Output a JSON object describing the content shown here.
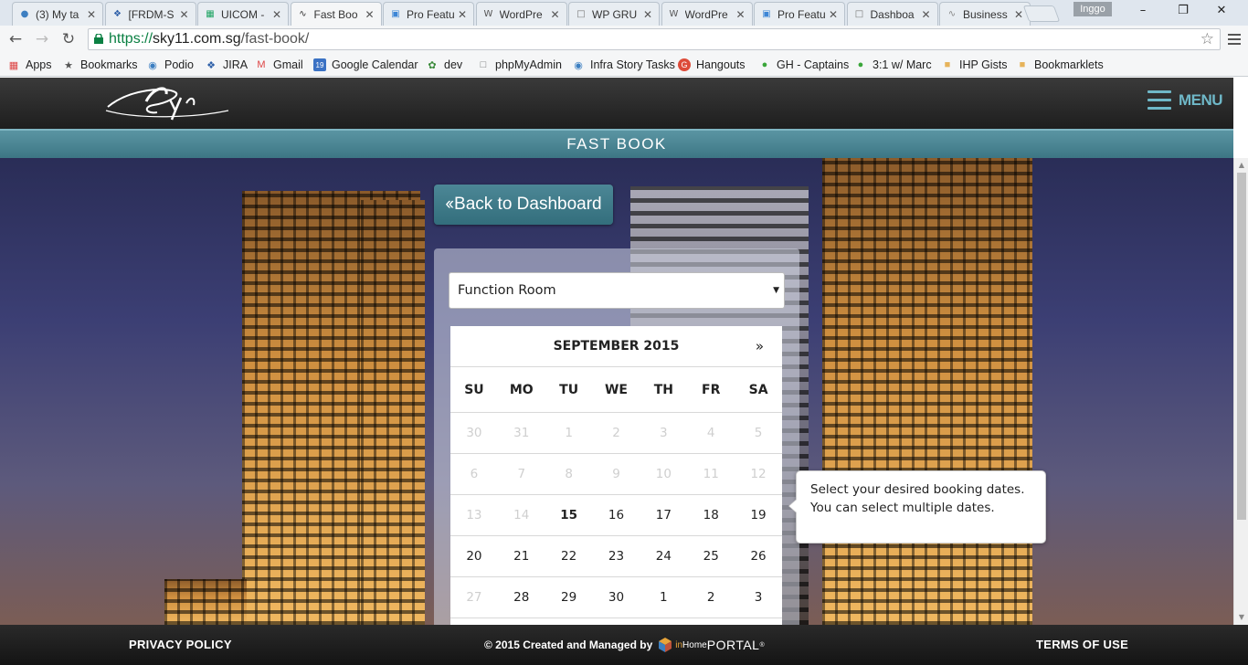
{
  "browser": {
    "tabs": [
      {
        "title": "(3) My ta",
        "icon": "podio-icon",
        "color": "#3d7fc1"
      },
      {
        "title": "[FRDM-S",
        "icon": "jira-icon",
        "color": "#2d5fa8"
      },
      {
        "title": "UICOM -",
        "icon": "sheets-icon",
        "color": "#1fa463"
      },
      {
        "title": "Fast Boo",
        "icon": "sky-icon",
        "color": "#333333",
        "active": true
      },
      {
        "title": "Pro Featu",
        "icon": "elementor-icon",
        "color": "#3d86d6"
      },
      {
        "title": "WordPre",
        "icon": "wordpress-icon",
        "color": "#555555"
      },
      {
        "title": "WP GRU",
        "icon": "page-icon",
        "color": "#777777"
      },
      {
        "title": "WordPre",
        "icon": "wordpress-icon",
        "color": "#555555"
      },
      {
        "title": "Pro Featu",
        "icon": "elementor-icon",
        "color": "#3d86d6"
      },
      {
        "title": "Dashboa",
        "icon": "page-icon",
        "color": "#777777"
      },
      {
        "title": "Business",
        "icon": "business-icon",
        "color": "#888888"
      }
    ],
    "profile_name": "Inggo",
    "url_secure": "https://",
    "url_host": "sky11.com.sg",
    "url_path": "/fast-book/",
    "bookmarks": [
      {
        "label": "Apps",
        "icon": "apps-grid-icon"
      },
      {
        "label": "Bookmarks",
        "icon": "star-icon"
      },
      {
        "label": "Podio",
        "icon": "podio-icon"
      },
      {
        "label": "JIRA",
        "icon": "jira-icon"
      },
      {
        "label": "Gmail",
        "icon": "gmail-icon"
      },
      {
        "label": "Google Calendar",
        "icon": "calendar-icon"
      },
      {
        "label": "dev",
        "icon": "leaf-icon"
      },
      {
        "label": "phpMyAdmin",
        "icon": "page-icon"
      },
      {
        "label": "Infra Story Tasks",
        "icon": "podio-icon"
      },
      {
        "label": "Hangouts",
        "icon": "google-plus-icon"
      },
      {
        "label": "GH - Captains",
        "icon": "green-dot-icon"
      },
      {
        "label": "3:1 w/ Marc",
        "icon": "green-dot-icon"
      },
      {
        "label": "IHP Gists",
        "icon": "folder-icon"
      },
      {
        "label": "Bookmarklets",
        "icon": "folder-icon"
      }
    ]
  },
  "site": {
    "menu_label": "MENU",
    "page_title": "FAST BOOK",
    "back_button": "Back to Dashboard",
    "facility_select": "Function Room",
    "calendar": {
      "month": "SEPTEMBER 2015",
      "next_label": "»",
      "weekdays": [
        "SU",
        "MO",
        "TU",
        "WE",
        "TH",
        "FR",
        "SA"
      ],
      "weeks": [
        [
          {
            "d": "30",
            "s": "muted"
          },
          {
            "d": "31",
            "s": "muted"
          },
          {
            "d": "1",
            "s": "muted"
          },
          {
            "d": "2",
            "s": "muted"
          },
          {
            "d": "3",
            "s": "muted"
          },
          {
            "d": "4",
            "s": "muted"
          },
          {
            "d": "5",
            "s": "muted"
          }
        ],
        [
          {
            "d": "6",
            "s": "muted"
          },
          {
            "d": "7",
            "s": "muted"
          },
          {
            "d": "8",
            "s": "muted"
          },
          {
            "d": "9",
            "s": "muted"
          },
          {
            "d": "10",
            "s": "muted"
          },
          {
            "d": "11",
            "s": "muted"
          },
          {
            "d": "12",
            "s": "muted"
          }
        ],
        [
          {
            "d": "13",
            "s": "muted"
          },
          {
            "d": "14",
            "s": "muted"
          },
          {
            "d": "15",
            "s": "bold"
          },
          {
            "d": "16",
            "s": "normal"
          },
          {
            "d": "17",
            "s": "normal"
          },
          {
            "d": "18",
            "s": "normal"
          },
          {
            "d": "19",
            "s": "normal"
          }
        ],
        [
          {
            "d": "20",
            "s": "normal"
          },
          {
            "d": "21",
            "s": "normal"
          },
          {
            "d": "22",
            "s": "normal"
          },
          {
            "d": "23",
            "s": "normal"
          },
          {
            "d": "24",
            "s": "normal"
          },
          {
            "d": "25",
            "s": "normal"
          },
          {
            "d": "26",
            "s": "normal"
          }
        ],
        [
          {
            "d": "27",
            "s": "muted"
          },
          {
            "d": "28",
            "s": "normal"
          },
          {
            "d": "29",
            "s": "normal"
          },
          {
            "d": "30",
            "s": "normal"
          },
          {
            "d": "1",
            "s": "normal"
          },
          {
            "d": "2",
            "s": "normal"
          },
          {
            "d": "3",
            "s": "normal"
          }
        ]
      ]
    },
    "tooltip": {
      "line1": "Select your desired booking dates.",
      "line2": "You can select multiple dates."
    },
    "footer": {
      "privacy": "PRIVACY POLICY",
      "credit": "© 2015 Created and Managed by",
      "portal_in": "in",
      "portal_home": "Home",
      "portal_word": "PORTAL",
      "portal_reg": "®",
      "terms": "TERMS OF USE"
    },
    "accent_color": "#4c8796"
  }
}
